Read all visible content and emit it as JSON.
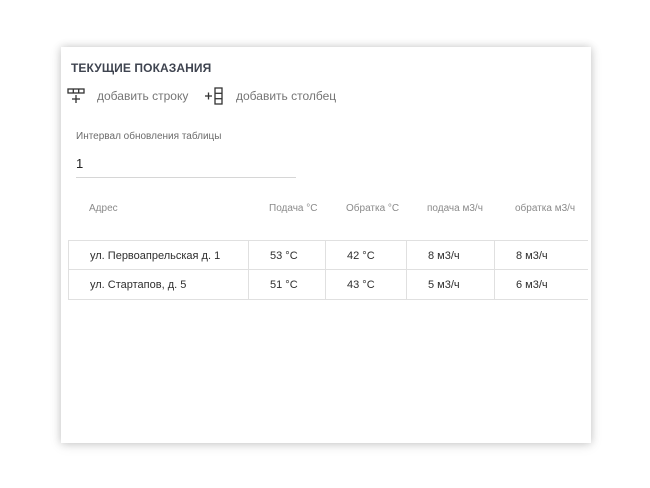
{
  "panel": {
    "title": "ТЕКУЩИЕ ПОКАЗАНИЯ"
  },
  "toolbar": {
    "add_row_label": "добавить строку",
    "add_row_icon": "add-row-icon",
    "add_column_label": "добавить столбец",
    "add_column_icon": "add-column-icon"
  },
  "interval": {
    "label": "Интервал обновления таблицы",
    "value": "1"
  },
  "table": {
    "headers": [
      "Адрес",
      "Подача °С",
      "Обратка °С",
      "подача м3/ч",
      "обратка м3/ч"
    ],
    "rows": [
      [
        "ул. Первоапрельская д. 1",
        "53 °С",
        "42 °С",
        "8 м3/ч",
        "8 м3/ч"
      ],
      [
        "ул. Стартапов, д. 5",
        "51 °С",
        "43 °С",
        "5 м3/ч",
        "6 м3/ч"
      ]
    ]
  },
  "colors": {
    "title": "#3f4450",
    "muted_text": "#757575",
    "border": "#e0e0e0",
    "icon": "#333333"
  }
}
